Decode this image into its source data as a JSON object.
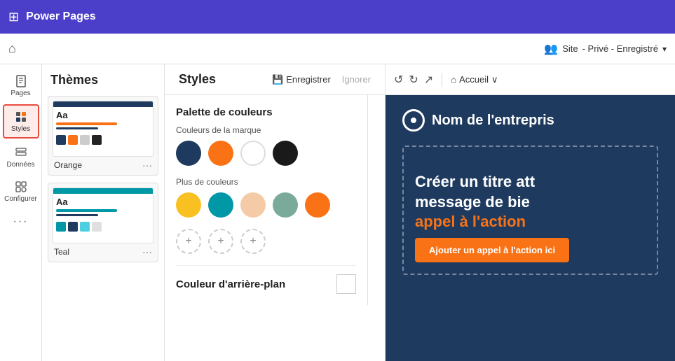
{
  "topBar": {
    "appName": "Power Pages",
    "gridIcon": "⊞"
  },
  "secondBar": {
    "homeIcon": "⌂",
    "siteLabel": "Site",
    "siteStatus": " - Privé - Enregistré"
  },
  "sidebar": {
    "items": [
      {
        "id": "pages",
        "label": "Pages",
        "icon": "page"
      },
      {
        "id": "styles",
        "label": "Styles",
        "icon": "styles",
        "active": true
      },
      {
        "id": "donnees",
        "label": "Données",
        "icon": "data"
      },
      {
        "id": "configurer",
        "label": "Configurer",
        "icon": "config"
      }
    ],
    "moreLabel": "..."
  },
  "themesPanel": {
    "title": "Thèmes",
    "themes": [
      {
        "id": "orange",
        "name": "Orange",
        "accentColor": "#f97316",
        "topColor": "#1e3a5f",
        "colors": [
          "#1e3a5f",
          "#f97316",
          "#e0e0e0",
          "#1a1a1a"
        ]
      },
      {
        "id": "teal",
        "name": "Teal",
        "accentColor": "#0097a7",
        "topColor": "#0097a7",
        "colors": [
          "#0097a7",
          "#1e3a5f",
          "#4dd0e1",
          "#e0e0e0"
        ]
      }
    ]
  },
  "stylesHeader": {
    "title": "Styles",
    "saveLabel": "Enregistrer",
    "ignoreLabel": "Ignorer",
    "saveIcon": "💾"
  },
  "palette": {
    "sectionTitle": "Palette de couleurs",
    "brandColorsLabel": "Couleurs de la marque",
    "brandColors": [
      {
        "id": "navy",
        "hex": "#1e3a5f"
      },
      {
        "id": "orange",
        "hex": "#f97316"
      },
      {
        "id": "white",
        "hex": "#ffffff",
        "border": "#ddd"
      },
      {
        "id": "black",
        "hex": "#1a1a1a"
      }
    ],
    "moreColorsLabel": "Plus de couleurs",
    "moreColors": [
      {
        "id": "yellow",
        "hex": "#f9c022"
      },
      {
        "id": "teal",
        "hex": "#0097a7"
      },
      {
        "id": "peach",
        "hex": "#f5cba7"
      },
      {
        "id": "sage",
        "hex": "#7aab9a"
      },
      {
        "id": "orange2",
        "hex": "#f97316"
      }
    ],
    "addLabel": "+",
    "bgColorLabel": "Couleur d'arrière-plan"
  },
  "preview": {
    "undoIcon": "↺",
    "redoIcon": "↻",
    "shareIcon": "↗",
    "homeLabel": "Accueil",
    "chevronIcon": "∨",
    "companyName": "Nom de l'entrepris",
    "heading1": "Créer un titre att",
    "heading2": "message de bie",
    "heading3": "appel à l'action",
    "ctaLabel": "Ajouter un appel à l'action ici"
  }
}
